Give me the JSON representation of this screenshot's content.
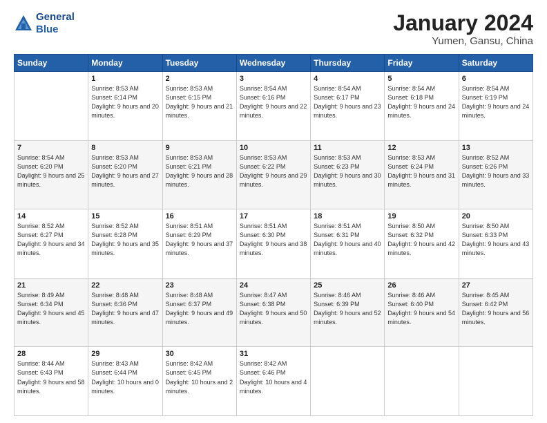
{
  "header": {
    "logo_line1": "General",
    "logo_line2": "Blue",
    "title": "January 2024",
    "subtitle": "Yumen, Gansu, China"
  },
  "days_of_week": [
    "Sunday",
    "Monday",
    "Tuesday",
    "Wednesday",
    "Thursday",
    "Friday",
    "Saturday"
  ],
  "weeks": [
    [
      {
        "day": "",
        "sunrise": "",
        "sunset": "",
        "daylight": ""
      },
      {
        "day": "1",
        "sunrise": "Sunrise: 8:53 AM",
        "sunset": "Sunset: 6:14 PM",
        "daylight": "Daylight: 9 hours and 20 minutes."
      },
      {
        "day": "2",
        "sunrise": "Sunrise: 8:53 AM",
        "sunset": "Sunset: 6:15 PM",
        "daylight": "Daylight: 9 hours and 21 minutes."
      },
      {
        "day": "3",
        "sunrise": "Sunrise: 8:54 AM",
        "sunset": "Sunset: 6:16 PM",
        "daylight": "Daylight: 9 hours and 22 minutes."
      },
      {
        "day": "4",
        "sunrise": "Sunrise: 8:54 AM",
        "sunset": "Sunset: 6:17 PM",
        "daylight": "Daylight: 9 hours and 23 minutes."
      },
      {
        "day": "5",
        "sunrise": "Sunrise: 8:54 AM",
        "sunset": "Sunset: 6:18 PM",
        "daylight": "Daylight: 9 hours and 24 minutes."
      },
      {
        "day": "6",
        "sunrise": "Sunrise: 8:54 AM",
        "sunset": "Sunset: 6:19 PM",
        "daylight": "Daylight: 9 hours and 24 minutes."
      }
    ],
    [
      {
        "day": "7",
        "sunrise": "Sunrise: 8:54 AM",
        "sunset": "Sunset: 6:20 PM",
        "daylight": "Daylight: 9 hours and 25 minutes."
      },
      {
        "day": "8",
        "sunrise": "Sunrise: 8:53 AM",
        "sunset": "Sunset: 6:20 PM",
        "daylight": "Daylight: 9 hours and 27 minutes."
      },
      {
        "day": "9",
        "sunrise": "Sunrise: 8:53 AM",
        "sunset": "Sunset: 6:21 PM",
        "daylight": "Daylight: 9 hours and 28 minutes."
      },
      {
        "day": "10",
        "sunrise": "Sunrise: 8:53 AM",
        "sunset": "Sunset: 6:22 PM",
        "daylight": "Daylight: 9 hours and 29 minutes."
      },
      {
        "day": "11",
        "sunrise": "Sunrise: 8:53 AM",
        "sunset": "Sunset: 6:23 PM",
        "daylight": "Daylight: 9 hours and 30 minutes."
      },
      {
        "day": "12",
        "sunrise": "Sunrise: 8:53 AM",
        "sunset": "Sunset: 6:24 PM",
        "daylight": "Daylight: 9 hours and 31 minutes."
      },
      {
        "day": "13",
        "sunrise": "Sunrise: 8:52 AM",
        "sunset": "Sunset: 6:26 PM",
        "daylight": "Daylight: 9 hours and 33 minutes."
      }
    ],
    [
      {
        "day": "14",
        "sunrise": "Sunrise: 8:52 AM",
        "sunset": "Sunset: 6:27 PM",
        "daylight": "Daylight: 9 hours and 34 minutes."
      },
      {
        "day": "15",
        "sunrise": "Sunrise: 8:52 AM",
        "sunset": "Sunset: 6:28 PM",
        "daylight": "Daylight: 9 hours and 35 minutes."
      },
      {
        "day": "16",
        "sunrise": "Sunrise: 8:51 AM",
        "sunset": "Sunset: 6:29 PM",
        "daylight": "Daylight: 9 hours and 37 minutes."
      },
      {
        "day": "17",
        "sunrise": "Sunrise: 8:51 AM",
        "sunset": "Sunset: 6:30 PM",
        "daylight": "Daylight: 9 hours and 38 minutes."
      },
      {
        "day": "18",
        "sunrise": "Sunrise: 8:51 AM",
        "sunset": "Sunset: 6:31 PM",
        "daylight": "Daylight: 9 hours and 40 minutes."
      },
      {
        "day": "19",
        "sunrise": "Sunrise: 8:50 AM",
        "sunset": "Sunset: 6:32 PM",
        "daylight": "Daylight: 9 hours and 42 minutes."
      },
      {
        "day": "20",
        "sunrise": "Sunrise: 8:50 AM",
        "sunset": "Sunset: 6:33 PM",
        "daylight": "Daylight: 9 hours and 43 minutes."
      }
    ],
    [
      {
        "day": "21",
        "sunrise": "Sunrise: 8:49 AM",
        "sunset": "Sunset: 6:34 PM",
        "daylight": "Daylight: 9 hours and 45 minutes."
      },
      {
        "day": "22",
        "sunrise": "Sunrise: 8:48 AM",
        "sunset": "Sunset: 6:36 PM",
        "daylight": "Daylight: 9 hours and 47 minutes."
      },
      {
        "day": "23",
        "sunrise": "Sunrise: 8:48 AM",
        "sunset": "Sunset: 6:37 PM",
        "daylight": "Daylight: 9 hours and 49 minutes."
      },
      {
        "day": "24",
        "sunrise": "Sunrise: 8:47 AM",
        "sunset": "Sunset: 6:38 PM",
        "daylight": "Daylight: 9 hours and 50 minutes."
      },
      {
        "day": "25",
        "sunrise": "Sunrise: 8:46 AM",
        "sunset": "Sunset: 6:39 PM",
        "daylight": "Daylight: 9 hours and 52 minutes."
      },
      {
        "day": "26",
        "sunrise": "Sunrise: 8:46 AM",
        "sunset": "Sunset: 6:40 PM",
        "daylight": "Daylight: 9 hours and 54 minutes."
      },
      {
        "day": "27",
        "sunrise": "Sunrise: 8:45 AM",
        "sunset": "Sunset: 6:42 PM",
        "daylight": "Daylight: 9 hours and 56 minutes."
      }
    ],
    [
      {
        "day": "28",
        "sunrise": "Sunrise: 8:44 AM",
        "sunset": "Sunset: 6:43 PM",
        "daylight": "Daylight: 9 hours and 58 minutes."
      },
      {
        "day": "29",
        "sunrise": "Sunrise: 8:43 AM",
        "sunset": "Sunset: 6:44 PM",
        "daylight": "Daylight: 10 hours and 0 minutes."
      },
      {
        "day": "30",
        "sunrise": "Sunrise: 8:42 AM",
        "sunset": "Sunset: 6:45 PM",
        "daylight": "Daylight: 10 hours and 2 minutes."
      },
      {
        "day": "31",
        "sunrise": "Sunrise: 8:42 AM",
        "sunset": "Sunset: 6:46 PM",
        "daylight": "Daylight: 10 hours and 4 minutes."
      },
      {
        "day": "",
        "sunrise": "",
        "sunset": "",
        "daylight": ""
      },
      {
        "day": "",
        "sunrise": "",
        "sunset": "",
        "daylight": ""
      },
      {
        "day": "",
        "sunrise": "",
        "sunset": "",
        "daylight": ""
      }
    ]
  ]
}
